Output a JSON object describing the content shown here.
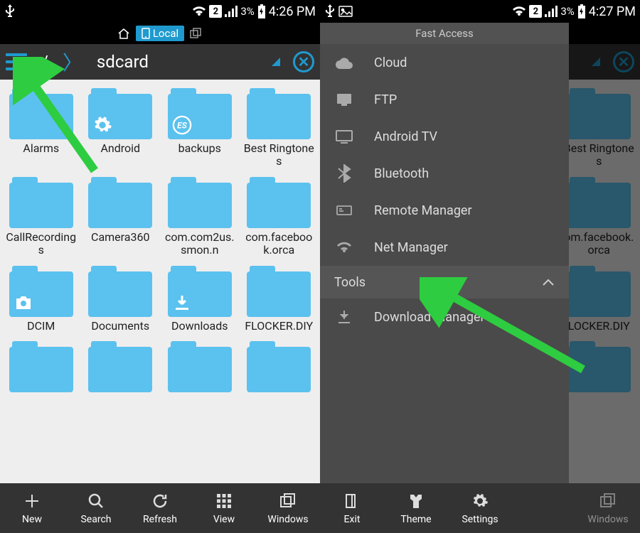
{
  "status": {
    "battery": "3%",
    "time_left": "4:26 PM",
    "time_right": "4:27 PM",
    "sim": "2"
  },
  "tabs": {
    "local": "Local"
  },
  "path": {
    "root": "/",
    "current": "sdcard"
  },
  "folders": [
    {
      "name": "Alarms"
    },
    {
      "name": "Android",
      "overlay": "gear"
    },
    {
      "name": "backups",
      "overlay": "es"
    },
    {
      "name": "Best Ringtones"
    },
    {
      "name": "CallRecordings"
    },
    {
      "name": "Camera360"
    },
    {
      "name": "com.com2us.smon.n"
    },
    {
      "name": "com.facebook.orca"
    },
    {
      "name": "DCIM",
      "overlay": "camera"
    },
    {
      "name": "Documents"
    },
    {
      "name": "Downloads",
      "overlay": "download"
    },
    {
      "name": "FLOCKER.DIY"
    }
  ],
  "right_folders_visible": [
    {
      "name": "Best Ringtones"
    },
    {
      "name": "om.facebook.orca"
    },
    {
      "name": "LOCKER.DIY"
    }
  ],
  "bottom_left": [
    {
      "label": "New"
    },
    {
      "label": "Search"
    },
    {
      "label": "Refresh"
    },
    {
      "label": "View"
    },
    {
      "label": "Windows"
    }
  ],
  "bottom_right": [
    {
      "label": "Exit"
    },
    {
      "label": "Theme"
    },
    {
      "label": "Settings"
    },
    {
      "label": "Windows"
    }
  ],
  "drawer": {
    "title": "Fast Access",
    "items": [
      {
        "label": "Cloud"
      },
      {
        "label": "FTP"
      },
      {
        "label": "Android TV"
      },
      {
        "label": "Bluetooth"
      },
      {
        "label": "Remote Manager"
      },
      {
        "label": "Net Manager"
      }
    ],
    "section": "Tools",
    "tools": [
      {
        "label": "Download Manager"
      }
    ]
  }
}
